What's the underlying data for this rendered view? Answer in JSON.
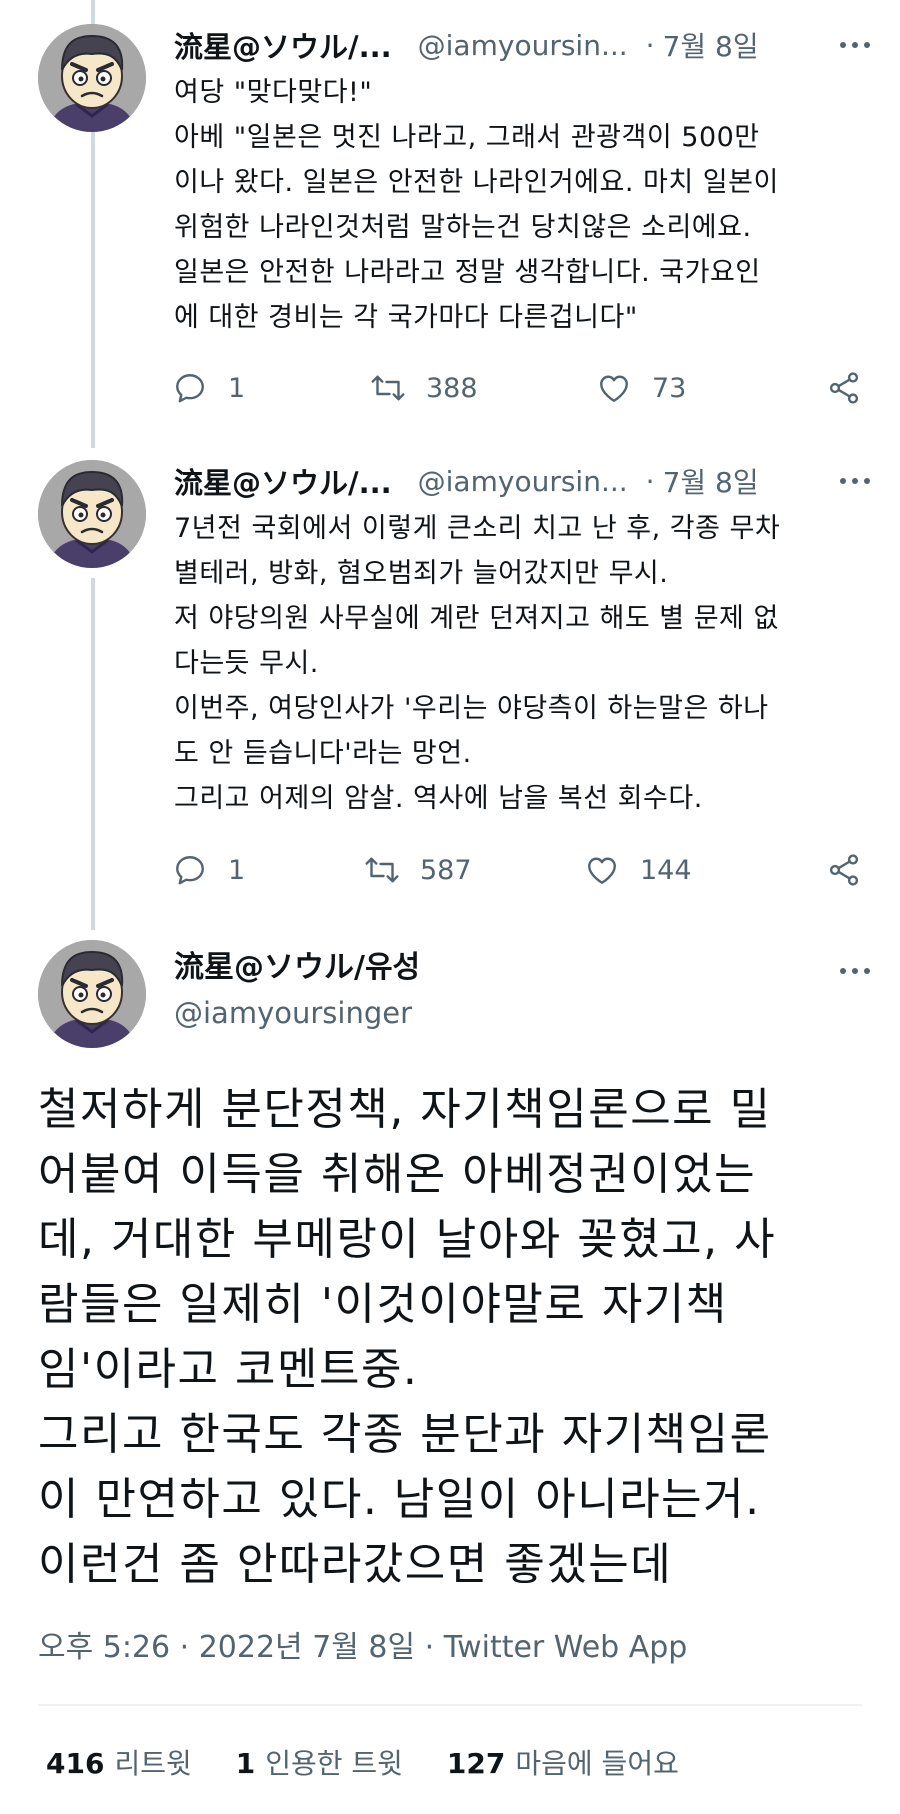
{
  "tweets": [
    {
      "name": "流星@ソウル/...",
      "handle": "@iamyoursin...",
      "dot": "·",
      "date": "7월 8일",
      "lines": [
        "여당 \"맞다맞다!\"",
        "아베 \"일본은 멋진 나라고, 그래서 관광객이 500만",
        "이나 왔다. 일본은 안전한 나라인거에요. 마치 일본이",
        "위험한 나라인것처럼 말하는건 당치않은 소리에요.",
        "일본은 안전한 나라라고 정말 생각합니다. 국가요인",
        "에 대한 경비는 각 국가마다 다른겁니다\""
      ],
      "replies": "1",
      "retweets": "388",
      "likes": "73"
    },
    {
      "name": "流星@ソウル/...",
      "handle": "@iamyoursin...",
      "dot": "·",
      "date": "7월 8일",
      "lines": [
        "7년전 국회에서 이렇게 큰소리 치고 난 후, 각종 무차",
        "별테러, 방화, 혐오범죄가 늘어갔지만 무시.",
        "저 야당의원 사무실에 계란 던져지고 해도 별 문제 없",
        "다는듯 무시.",
        "이번주, 여당인사가 '우리는 야당측이 하는말은 하나",
        "도 안 듣습니다'라는 망언.",
        "그리고 어제의 암살. 역사에 남을 복선 회수다."
      ],
      "replies": "1",
      "retweets": "587",
      "likes": "144"
    }
  ],
  "main_tweet": {
    "name": "流星@ソウル/유성",
    "handle": "@iamyoursinger",
    "lines": [
      "철저하게 분단정책, 자기책임론으로 밀",
      "어붙여 이득을 취해온 아베정권이었는",
      "데, 거대한 부메랑이 날아와 꽂혔고, 사",
      "람들은 일제히 '이것이야말로 자기책",
      "임'이라고 코멘트중.",
      "그리고 한국도 각종 분단과 자기책임론",
      "이 만연하고 있다. 남일이 아니라는거.",
      "이런건 좀 안따라갔으면 좋겠는데"
    ],
    "timestamp": "오후 5:26 · 2022년 7월 8일 · Twitter Web App",
    "stats": [
      {
        "count": "416",
        "label": "리트윗"
      },
      {
        "count": "1",
        "label": "인용한 트윗"
      },
      {
        "count": "127",
        "label": "마음에 들어요"
      }
    ]
  },
  "icons": {
    "reply": "reply-icon",
    "retweet": "retweet-icon",
    "like": "heart-icon",
    "share": "share-icon",
    "more": "more-icon"
  },
  "colors": {
    "text": "#0f1419",
    "secondary": "#536471",
    "thread_line": "#cfd9de"
  }
}
